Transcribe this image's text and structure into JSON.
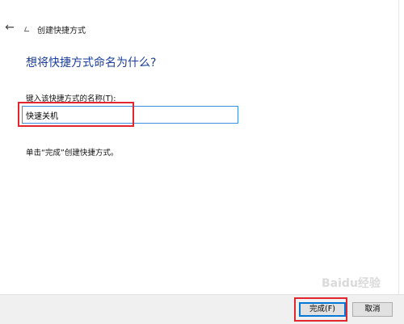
{
  "window": {
    "title": "创建快捷方式",
    "back_icon": "←"
  },
  "main": {
    "heading": "想将快捷方式命名为什么?",
    "field_label": "键入该快捷方式的名称(T):",
    "name_value": "快速关机",
    "instruction": "单击“完成”创建快捷方式。"
  },
  "footer": {
    "finish_label": "完成(F)",
    "cancel_label": "取消"
  },
  "watermark": "Baidu经验",
  "colors": {
    "heading": "#1a3e9a",
    "highlight": "#e3262d",
    "focus_border": "#3c8fdf",
    "footer_bg": "#f0f0f0"
  }
}
